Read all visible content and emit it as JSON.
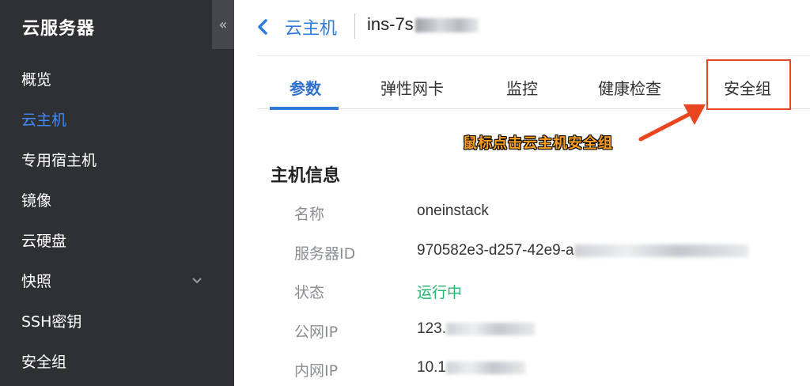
{
  "sidebar": {
    "title": "云服务器",
    "collapse_icon": "«",
    "items": [
      {
        "label": "概览"
      },
      {
        "label": "云主机",
        "active": true
      },
      {
        "label": "专用宿主机"
      },
      {
        "label": "镜像"
      },
      {
        "label": "云硬盘"
      },
      {
        "label": "快照",
        "has_submenu": true
      },
      {
        "label": "SSH密钥"
      },
      {
        "label": "安全组"
      }
    ],
    "colors": {
      "background": "#2f3033",
      "active": "#3d8bff"
    }
  },
  "header": {
    "back_icon": "chevron-left-icon",
    "parent": "云主机",
    "current": "ins-7s"
  },
  "tabs": [
    {
      "label": "参数",
      "active": true
    },
    {
      "label": "弹性网卡"
    },
    {
      "label": "监控"
    },
    {
      "label": "健康检查"
    },
    {
      "label": "安全组",
      "highlighted": true
    }
  ],
  "annotation": {
    "text": "鼠标点击云主机安全组",
    "color": "#ff9f1a"
  },
  "host_info": {
    "title": "主机信息",
    "rows": [
      {
        "label": "名称",
        "value": "oneinstack"
      },
      {
        "label": "服务器ID",
        "value": "970582e3-d257-42e9-a"
      },
      {
        "label": "状态",
        "value": "运行中",
        "status_color": "#1fb86b"
      },
      {
        "label": "公网IP",
        "value": "123."
      },
      {
        "label": "内网IP",
        "value": "10.1"
      }
    ]
  }
}
